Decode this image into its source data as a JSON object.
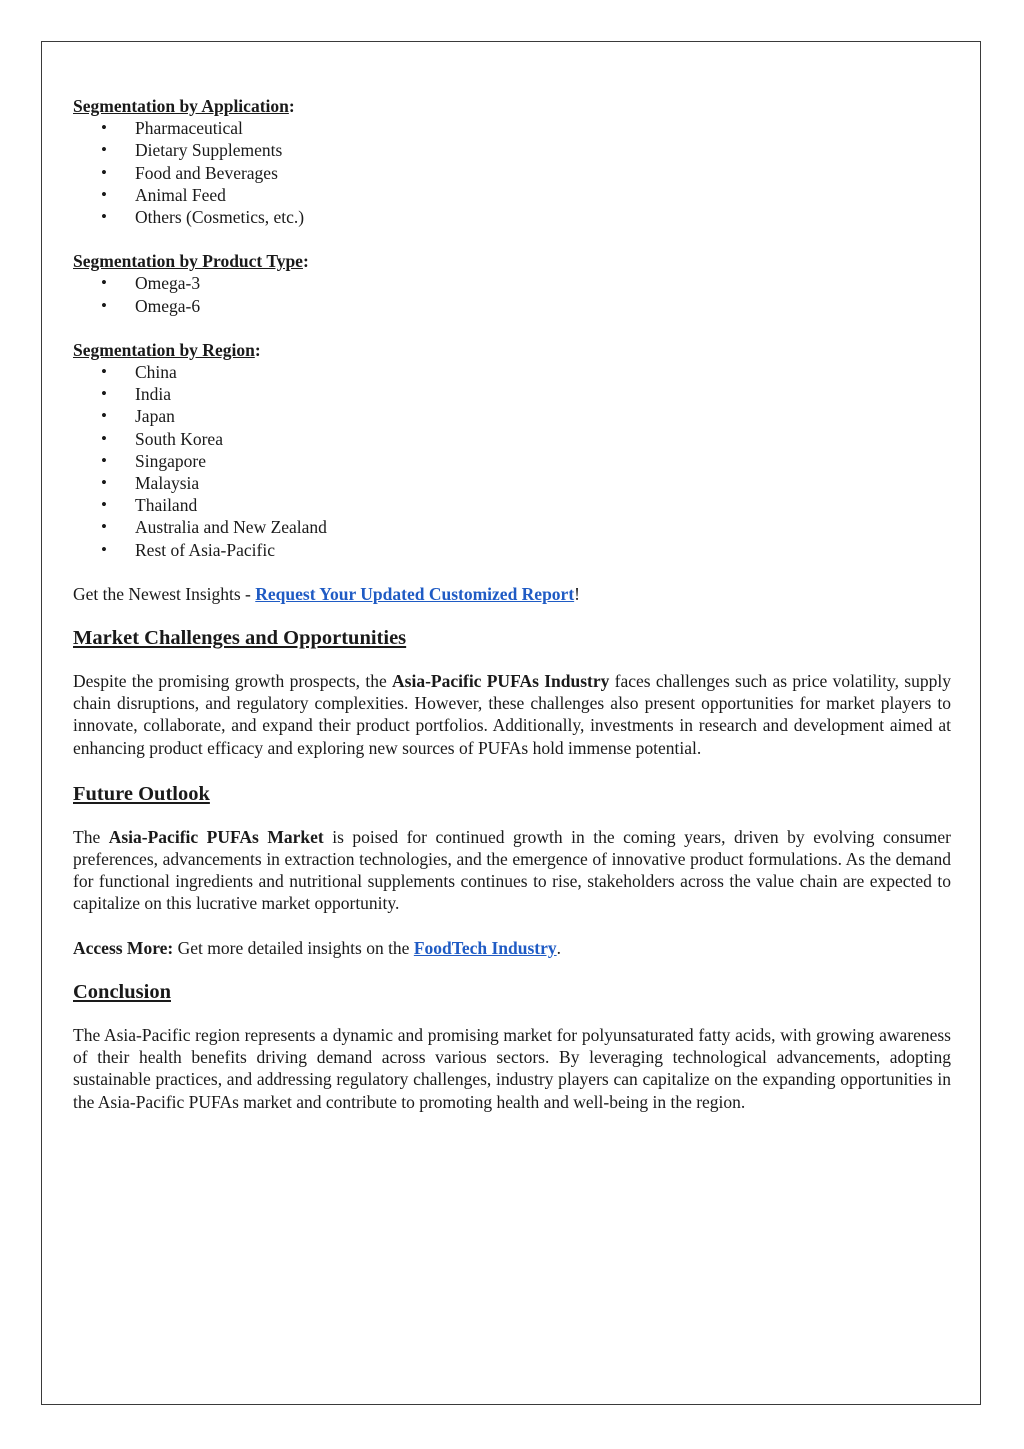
{
  "segmentation_application": {
    "heading": "Segmentation by Application",
    "suffix": ":",
    "items": [
      "Pharmaceutical",
      "Dietary Supplements",
      "Food and Beverages",
      "Animal Feed",
      "Others (Cosmetics, etc.)"
    ]
  },
  "segmentation_product": {
    "heading": "Segmentation by Product Type",
    "suffix": ":",
    "items": [
      "Omega-3",
      "Omega-6"
    ]
  },
  "segmentation_region": {
    "heading": "Segmentation by Region",
    "suffix": ":",
    "items": [
      "China",
      "India",
      "Japan",
      "South Korea",
      "Singapore",
      "Malaysia",
      "Thailand",
      "Australia and New Zealand",
      "Rest of Asia-Pacific"
    ]
  },
  "insights": {
    "prefix": "Get the Newest Insights - ",
    "link": "Request Your Updated Customized Report",
    "suffix": "!"
  },
  "challenges": {
    "heading": "Market Challenges and Opportunities",
    "text_before": "Despite the promising growth prospects, the ",
    "bold": "Asia-Pacific PUFAs Industry",
    "text_after": " faces challenges such as price volatility, supply chain disruptions, and regulatory complexities. However, these challenges also present opportunities for market players to innovate, collaborate, and expand their product portfolios. Additionally, investments in research and development aimed at enhancing product efficacy and exploring new sources of PUFAs hold immense potential."
  },
  "outlook": {
    "heading": "Future Outlook",
    "text_before": "The ",
    "bold": "Asia-Pacific PUFAs Market",
    "text_after": " is poised for continued growth in the coming years, driven by evolving consumer preferences, advancements in extraction technologies, and the emergence of innovative product formulations. As the demand for functional ingredients and nutritional supplements continues to rise, stakeholders across the value chain are expected to capitalize on this lucrative market opportunity."
  },
  "access_more": {
    "label": "Access More:",
    "text": " Get more detailed insights on the ",
    "link": "FoodTech Industry",
    "suffix": "."
  },
  "conclusion": {
    "heading": "Conclusion",
    "text": "The Asia-Pacific region represents a dynamic and promising market for polyunsaturated fatty acids, with growing awareness of their health benefits driving demand across various sectors. By leveraging technological advancements, adopting sustainable practices, and addressing regulatory challenges, industry players can capitalize on the expanding opportunities in the Asia-Pacific PUFAs market and contribute to promoting health and well-being in the region."
  },
  "colors": {
    "link": "#1f5bc4",
    "text": "#1a1a1a",
    "border": "#3a3a3a"
  }
}
